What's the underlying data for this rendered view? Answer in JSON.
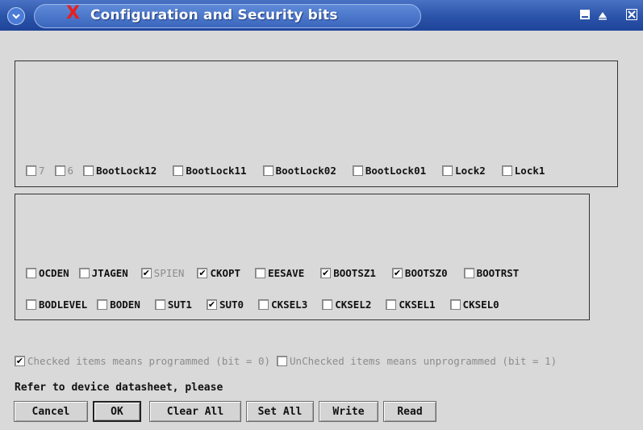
{
  "window": {
    "title": "Configuration and Security bits",
    "title_x_glyph": "X"
  },
  "lock_bits": [
    {
      "label": "7",
      "checked": false,
      "enabled": false
    },
    {
      "label": "6",
      "checked": false,
      "enabled": false
    },
    {
      "label": "BootLock12",
      "checked": false,
      "enabled": true
    },
    {
      "label": "BootLock11",
      "checked": false,
      "enabled": true
    },
    {
      "label": "BootLock02",
      "checked": false,
      "enabled": true
    },
    {
      "label": "BootLock01",
      "checked": false,
      "enabled": true
    },
    {
      "label": "Lock2",
      "checked": false,
      "enabled": true
    },
    {
      "label": "Lock1",
      "checked": false,
      "enabled": true
    }
  ],
  "fuse_high": [
    {
      "label": "OCDEN",
      "checked": false,
      "enabled": true
    },
    {
      "label": "JTAGEN",
      "checked": false,
      "enabled": true
    },
    {
      "label": "SPIEN",
      "checked": true,
      "enabled": false
    },
    {
      "label": "CKOPT",
      "checked": true,
      "enabled": true
    },
    {
      "label": "EESAVE",
      "checked": false,
      "enabled": true
    },
    {
      "label": "BOOTSZ1",
      "checked": true,
      "enabled": true
    },
    {
      "label": "BOOTSZ0",
      "checked": true,
      "enabled": true
    },
    {
      "label": "BOOTRST",
      "checked": false,
      "enabled": true
    }
  ],
  "fuse_low": [
    {
      "label": "BODLEVEL",
      "checked": false,
      "enabled": true
    },
    {
      "label": "BODEN",
      "checked": false,
      "enabled": true
    },
    {
      "label": "SUT1",
      "checked": false,
      "enabled": true
    },
    {
      "label": "SUT0",
      "checked": true,
      "enabled": true
    },
    {
      "label": "CKSEL3",
      "checked": false,
      "enabled": true
    },
    {
      "label": "CKSEL2",
      "checked": false,
      "enabled": true
    },
    {
      "label": "CKSEL1",
      "checked": false,
      "enabled": true
    },
    {
      "label": "CKSEL0",
      "checked": false,
      "enabled": true
    }
  ],
  "legend": {
    "checked_text": "Checked items means programmed (bit = 0)",
    "unchecked_text": "UnChecked items means unprogrammed (bit = 1)"
  },
  "note": "Refer to device datasheet, please",
  "buttons": {
    "cancel": "Cancel",
    "ok": "OK",
    "clear_all": "Clear All",
    "set_all": "Set All",
    "write": "Write",
    "read": "Read"
  },
  "check_glyph": "✔",
  "colors": {
    "titlebar": "#2a53a8",
    "title_x": "#e62020",
    "background": "#d9d9d9"
  }
}
